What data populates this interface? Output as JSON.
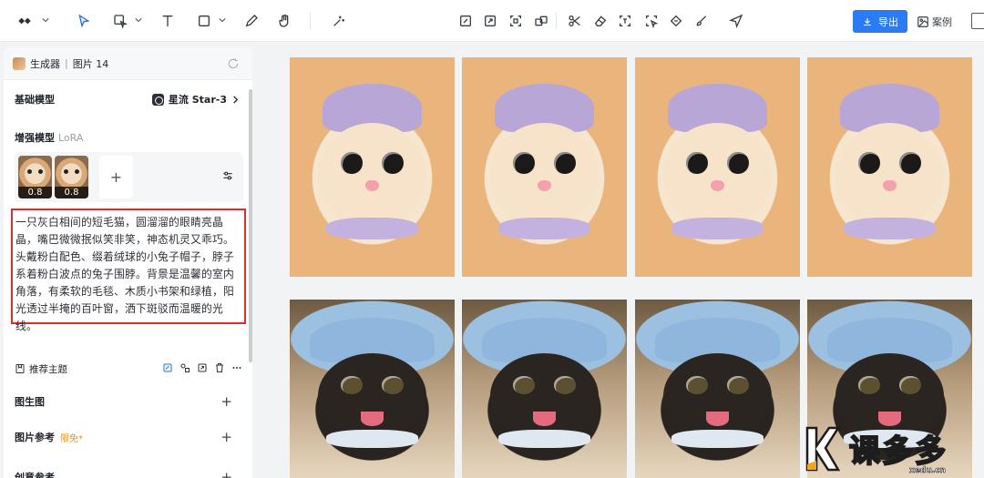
{
  "toolbar": {
    "tools": [
      "logo-icon",
      "cursor-icon",
      "lasso-select-icon",
      "text-icon",
      "shape-icon",
      "pen-icon",
      "hand-icon",
      "magic-wand-icon"
    ],
    "edit_tools": [
      "edit-icon",
      "expand-icon",
      "crop-icon",
      "transform-icon",
      "scissors-icon",
      "eraser-icon",
      "text-detect-icon",
      "smart-select-icon",
      "upscale-icon",
      "repaint-icon",
      "send-icon"
    ],
    "export_label": "导出",
    "case_label": "案例"
  },
  "panel": {
    "header_title": "生成器",
    "header_separator": "|",
    "header_count": "图片 14",
    "base_model_label": "基础模型",
    "base_model_value": "星流 Star-3",
    "enhance_label": "增强模型",
    "enhance_tag": "LoRA",
    "lora_items": [
      {
        "weight": "0.8"
      },
      {
        "weight": "0.8"
      }
    ],
    "lora_add": "+",
    "prompt": "一只灰白相间的短毛猫，圆溜溜的眼睛亮晶晶，嘴巴微微抿似笑非笑，神态机灵又乖巧。头戴粉白配色、缀着绒球的小兔子帽子，脖子系着粉白波点的兔子围脖。背景是温馨的室内角落，有柔软的毛毯、木质小书架和绿植，阳光透过半掩的百叶窗，洒下斑驳而温暖的光线。",
    "topic_label": "推荐主题",
    "sections": [
      {
        "label": "图生图",
        "tag": ""
      },
      {
        "label": "图片参考",
        "tag": "限免*"
      },
      {
        "label": "创意参考",
        "tag": ""
      }
    ]
  },
  "images": [
    {
      "kind": "cream-cat-purple-hat"
    },
    {
      "kind": "cream-cat-purple-hat"
    },
    {
      "kind": "cream-cat-purple-hat"
    },
    {
      "kind": "cream-cat-purple-hat"
    },
    {
      "kind": "black-cat-blue-hat"
    },
    {
      "kind": "black-cat-blue-hat"
    },
    {
      "kind": "black-cat-blue-hat"
    },
    {
      "kind": "black-cat-blue-hat"
    }
  ],
  "watermark": {
    "text": "课多多",
    "url": "xedu.cn"
  }
}
